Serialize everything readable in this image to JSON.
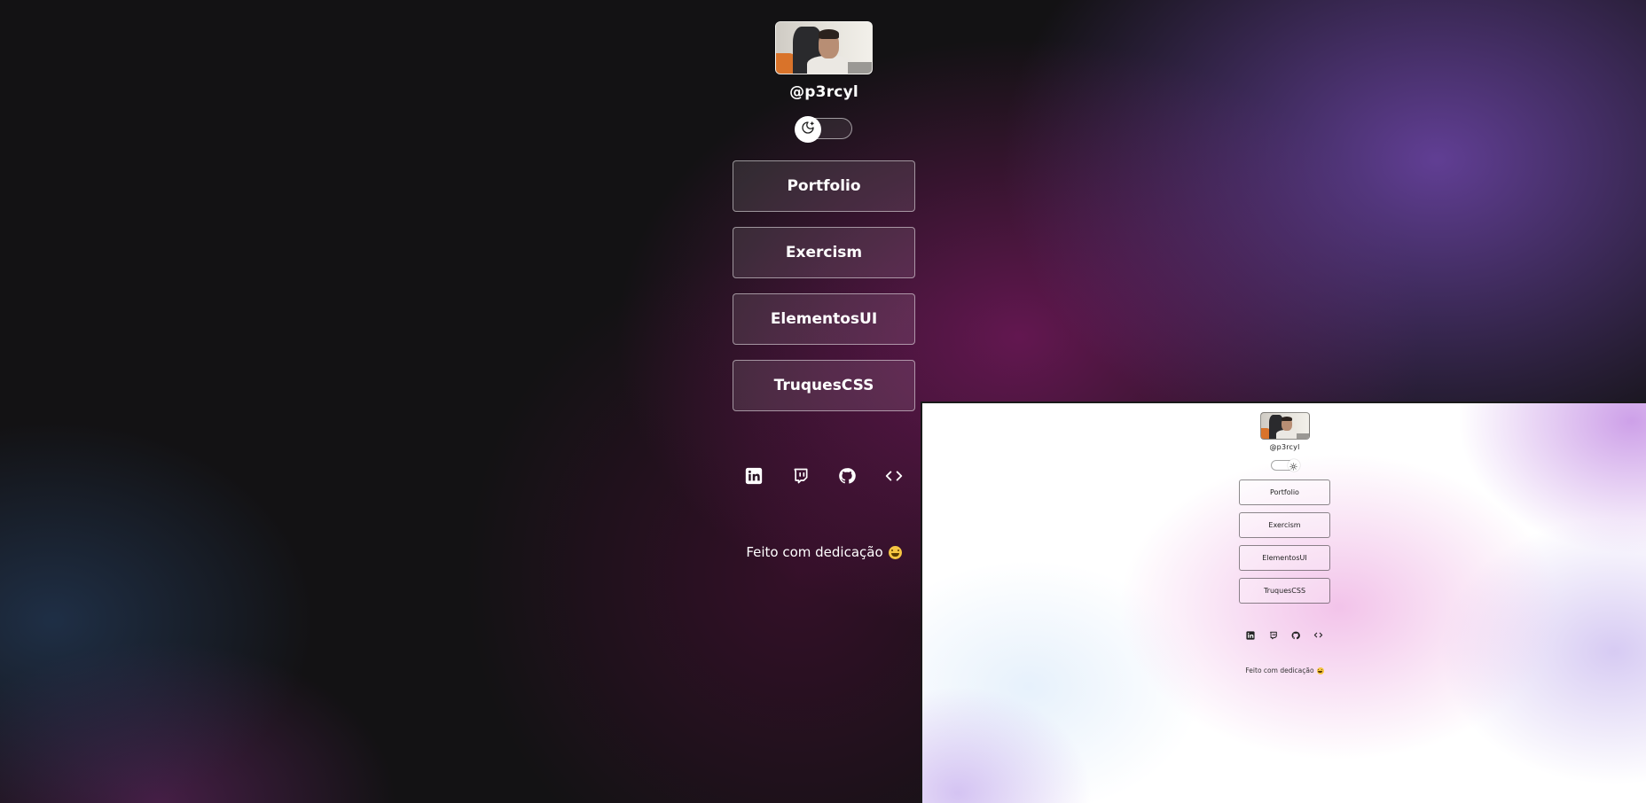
{
  "profile": {
    "handle": "@p3rcyl"
  },
  "theme_toggle": {
    "dark_icon": "moon-icon",
    "light_icon": "sun-icon"
  },
  "links": [
    {
      "label": "Portfolio"
    },
    {
      "label": "Exercism"
    },
    {
      "label": "ElementosUI"
    },
    {
      "label": "TruquesCSS"
    }
  ],
  "socials": [
    {
      "icon": "linkedin-icon"
    },
    {
      "icon": "twitch-icon"
    },
    {
      "icon": "github-icon"
    },
    {
      "icon": "code-icon"
    }
  ],
  "footer": {
    "text": "Feito com dedicação",
    "emoji": "grinning-emoji-icon"
  },
  "colors": {
    "dark_bg": "#131214",
    "dark_accent_purple": "#6e46aa",
    "dark_accent_magenta": "#7d1964",
    "light_bg": "#ffffff",
    "light_accent_pink": "#f0b9e6",
    "light_accent_lavender": "#c896e6"
  }
}
